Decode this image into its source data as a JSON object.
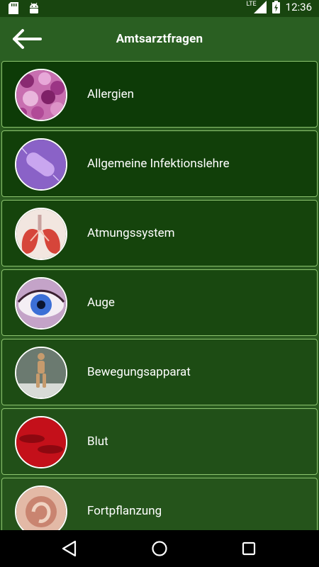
{
  "status_bar": {
    "time": "12:36",
    "network": "LTE",
    "icons": [
      "sd-card-icon",
      "android-icon",
      "signal-icon",
      "battery-icon"
    ]
  },
  "app_bar": {
    "title": "Amtsarztfragen",
    "back_icon": "arrow-left-icon"
  },
  "categories": [
    {
      "label": "Allergien",
      "image": "pollen-grains"
    },
    {
      "label": "Allgemeine Infektionslehre",
      "image": "bacterium"
    },
    {
      "label": "Atmungssystem",
      "image": "lungs"
    },
    {
      "label": "Auge",
      "image": "eye"
    },
    {
      "label": "Bewegungsapparat",
      "image": "wooden-figure"
    },
    {
      "label": "Blut",
      "image": "red-blood-cells"
    },
    {
      "label": "Fortpflanzung",
      "image": "fetus"
    }
  ],
  "nav_bar": {
    "icons": [
      "back-triangle-icon",
      "home-circle-icon",
      "recents-square-icon"
    ]
  },
  "colors": {
    "status_bar": "#18450f",
    "app_bar": "#2a5f22",
    "list_bg": "#2a5b1f",
    "item_border": "#8cc46f"
  }
}
